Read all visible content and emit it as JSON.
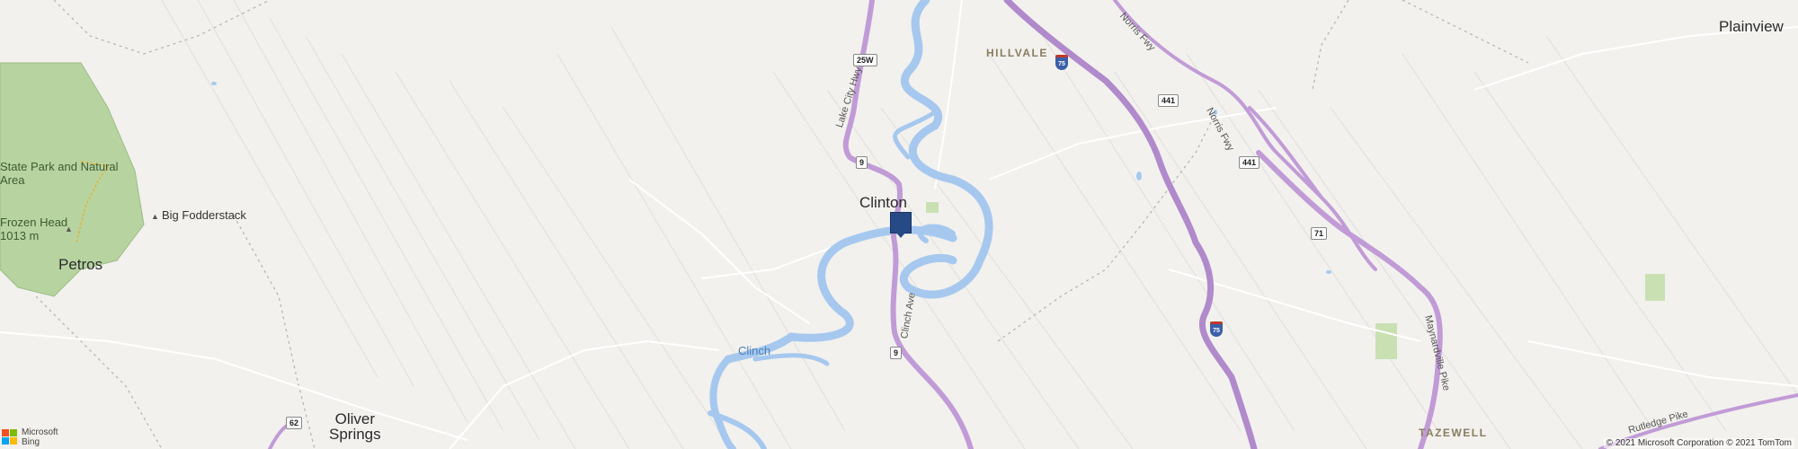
{
  "map": {
    "places": {
      "plainview": "Plainview",
      "hillvale": "HILLVALE",
      "clinton": "Clinton",
      "petros": "Petros",
      "oliver_springs": "Oliver\nSprings",
      "tazewell": "TAZEWELL",
      "park": "State Park and Natural\nArea",
      "frozen_head": "Frozen Head\n1013 m",
      "big_fodderstack": "Big Fodderstack"
    },
    "water": {
      "clinch": "Clinch"
    },
    "roads": {
      "lake_city_hwy": "Lake City Hwy",
      "clinch_ave": "Clinch Ave",
      "norris_fwy_1": "Norris Fwy",
      "norris_fwy_2": "Norris Fwy",
      "maynardville_pike": "Maynardville Pike",
      "rutledge_pike": "Rutledge Pike"
    },
    "shields": {
      "us25w": "25W",
      "tn9_north": "9",
      "tn9_south": "9",
      "us441_a": "441",
      "us441_b": "441",
      "tn71": "71",
      "tn62": "62",
      "i75_north": "75",
      "i75_south": "75"
    },
    "colors": {
      "background": "#f2f1ee",
      "water": "#a6c8ef",
      "park_green": "#b7d4a0",
      "highway": "#c19bd6",
      "interstate": "#b08acb",
      "minor_road": "#ffffff",
      "marker": "#264a86"
    },
    "marker_icon": "location-pin-icon"
  },
  "branding": {
    "provider_line1": "Microsoft",
    "provider_line2": "Bing",
    "logo_colors": [
      "#f25022",
      "#7fba00",
      "#00a4ef",
      "#ffb900"
    ],
    "copyright": "© 2021 Microsoft Corporation © 2021 TomTom"
  }
}
